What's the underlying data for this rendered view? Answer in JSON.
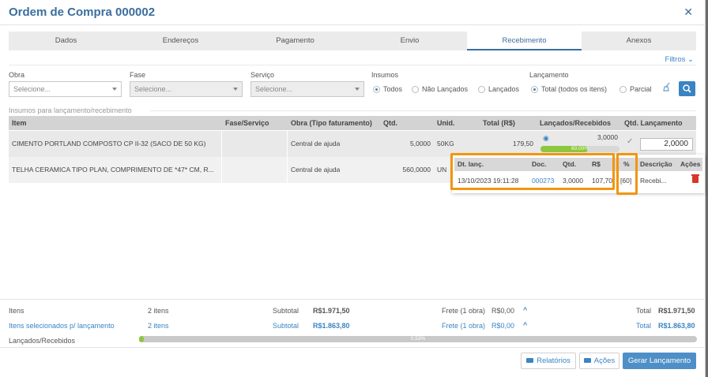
{
  "window": {
    "title": "Ordem de Compra 000002"
  },
  "tabs": [
    "Dados",
    "Endereços",
    "Pagamento",
    "Envio",
    "Recebimento",
    "Anexos"
  ],
  "active_tab": "Recebimento",
  "filters": {
    "toggle_label": "Filtros",
    "obra": {
      "label": "Obra",
      "placeholder": "Selecione..."
    },
    "fase": {
      "label": "Fase",
      "placeholder": "Selecione..."
    },
    "servico": {
      "label": "Serviço",
      "placeholder": "Selecione..."
    },
    "insumos": {
      "label": "Insumos",
      "options": [
        "Todos",
        "Não Lançados",
        "Lançados"
      ],
      "selected": "Todos"
    },
    "lancamento": {
      "label": "Lançamento",
      "options": [
        "Total (todos os itens)",
        "Parcial"
      ],
      "selected": "Total (todos os itens)"
    }
  },
  "section_title": "Insumos para lançamento/recebimento",
  "table": {
    "headers": [
      "Item",
      "Fase/Serviço",
      "Obra (Tipo faturamento)",
      "Qtd.",
      "Unid.",
      "Total (R$)",
      "Lançados/Recebidos",
      "Qtd. Lançamento"
    ],
    "rows": [
      {
        "item": "CIMENTO PORTLAND COMPOSTO CP II-32 (SACO DE 50 KG)",
        "fase": "",
        "obra": "Central de ajuda",
        "qtd": "5,0000",
        "unid": "50KG",
        "total": "179,50",
        "lancados": "3,0000",
        "progress_label": "60,00%",
        "progress": 0.6,
        "qtd_lancamento": "2,0000"
      },
      {
        "item": "TELHA CERAMICA TIPO PLAN, COMPRIMENTO DE *47* CM, R...",
        "fase": "",
        "obra": "Central de ajuda",
        "qtd": "560,0000",
        "unid": "UN"
      }
    ]
  },
  "popup": {
    "headers": [
      "Dt. lanç.",
      "Doc.",
      "Qtd.",
      "R$",
      "%",
      "Descrição",
      "Ações"
    ],
    "row": {
      "data": "13/10/2023 19:11:28",
      "doc": "000273",
      "qtd": "3,0000",
      "valor": "107,70",
      "pct": "[60]",
      "descricao": "Recebi..."
    }
  },
  "footer": {
    "itens": {
      "label": "Itens",
      "count": "2 itens",
      "subtotal_label": "Subtotal",
      "subtotal": "R$1.971,50",
      "frete_label": "Frete (1 obra)",
      "frete": "R$0,00",
      "total_label": "Total",
      "total": "R$1.971,50"
    },
    "selecionados": {
      "label": "Itens selecionados p/ lançamento",
      "count": "2 itens",
      "subtotal_label": "Subtotal",
      "subtotal": "R$1.863,80",
      "frete_label": "Frete (1 obra)",
      "frete": "R$0,00",
      "total_label": "Total",
      "total": "R$1.863,80"
    },
    "lancados": {
      "label": "Lançados/Recebidos",
      "progress_label": "0,53%",
      "progress": 0.0053
    }
  },
  "buttons": {
    "relatorios": "Relatórios",
    "acoes": "Ações",
    "gerar": "Gerar Lançamento"
  },
  "colors": {
    "accent": "#3a84c4",
    "title": "#3a6e9e",
    "highlight": "#f0960e",
    "progress": "#8dc63f",
    "delete": "#d9352a"
  }
}
